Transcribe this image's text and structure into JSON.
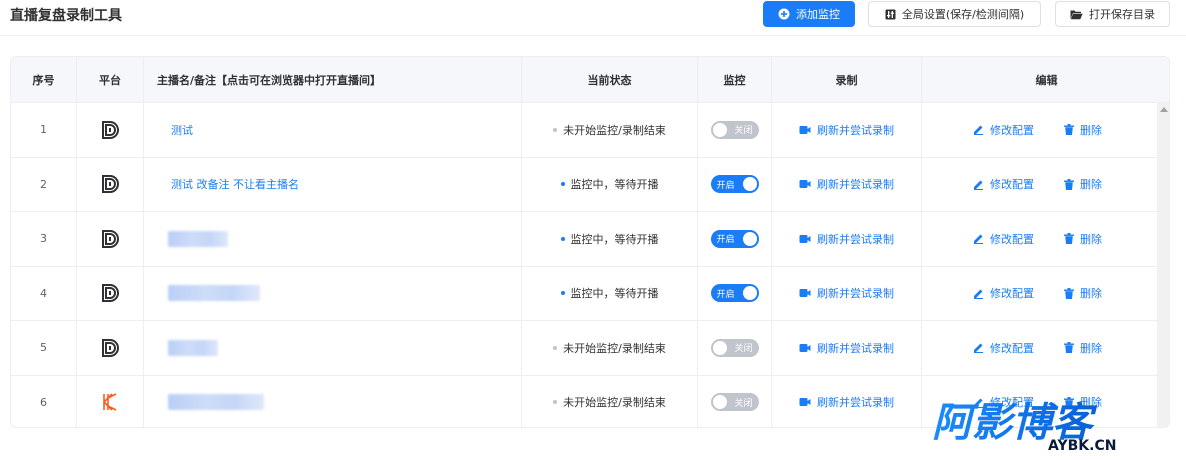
{
  "app": {
    "title": "直播复盘录制工具"
  },
  "toolbar": {
    "add_label": "添加监控",
    "settings_label": "全局设置(保存/检测间隔)",
    "open_dir_label": "打开保存目录"
  },
  "table": {
    "headers": {
      "index": "序号",
      "platform": "平台",
      "name": "主播名/备注【点击可在浏览器中打开直播间】",
      "status": "当前状态",
      "monitor": "监控",
      "record": "录制",
      "edit": "编辑"
    },
    "rows": [
      {
        "index": "1",
        "platform": "douyin-logo-icon",
        "name": "测试",
        "name_blurred": false,
        "status": "未开始监控/录制结束",
        "status_active": false,
        "monitor_on": false,
        "switch_label": "关闭",
        "record_label": "刷新并尝试录制",
        "edit_label": "修改配置",
        "delete_label": "删除"
      },
      {
        "index": "2",
        "platform": "douyin-logo-icon",
        "name": "测试 改备注 不让看主播名",
        "name_blurred": false,
        "status": "监控中，等待开播",
        "status_active": true,
        "monitor_on": true,
        "switch_label": "开启",
        "record_label": "刷新并尝试录制",
        "edit_label": "修改配置",
        "delete_label": "删除"
      },
      {
        "index": "3",
        "platform": "douyin-logo-icon",
        "name": "",
        "name_blurred": true,
        "status": "监控中，等待开播",
        "status_active": true,
        "monitor_on": true,
        "switch_label": "开启",
        "record_label": "刷新并尝试录制",
        "edit_label": "修改配置",
        "delete_label": "删除"
      },
      {
        "index": "4",
        "platform": "douyin-logo-icon",
        "name": "",
        "name_blurred": true,
        "status": "监控中，等待开播",
        "status_active": true,
        "monitor_on": true,
        "switch_label": "开启",
        "record_label": "刷新并尝试录制",
        "edit_label": "修改配置",
        "delete_label": "删除"
      },
      {
        "index": "5",
        "platform": "douyin-logo-icon",
        "name": "",
        "name_blurred": true,
        "status": "未开始监控/录制结束",
        "status_active": false,
        "monitor_on": false,
        "switch_label": "关闭",
        "record_label": "刷新并尝试录制",
        "edit_label": "修改配置",
        "delete_label": "删除"
      },
      {
        "index": "6",
        "platform": "kuaishou-logo-icon",
        "name": "",
        "name_blurred": true,
        "status": "未开始监控/录制结束",
        "status_active": false,
        "monitor_on": false,
        "switch_label": "关闭",
        "record_label": "刷新并尝试录制",
        "edit_label": "修改配置",
        "delete_label": "删除"
      }
    ]
  },
  "watermark": {
    "cn": "阿影博客",
    "en": "AYBK.CN"
  },
  "colors": {
    "primary": "#1a7cf7",
    "border": "#ebeef5",
    "header_bg": "#f5f7fa",
    "switch_off": "#c0c4cc",
    "kuaishou": "#ff5a1f"
  }
}
